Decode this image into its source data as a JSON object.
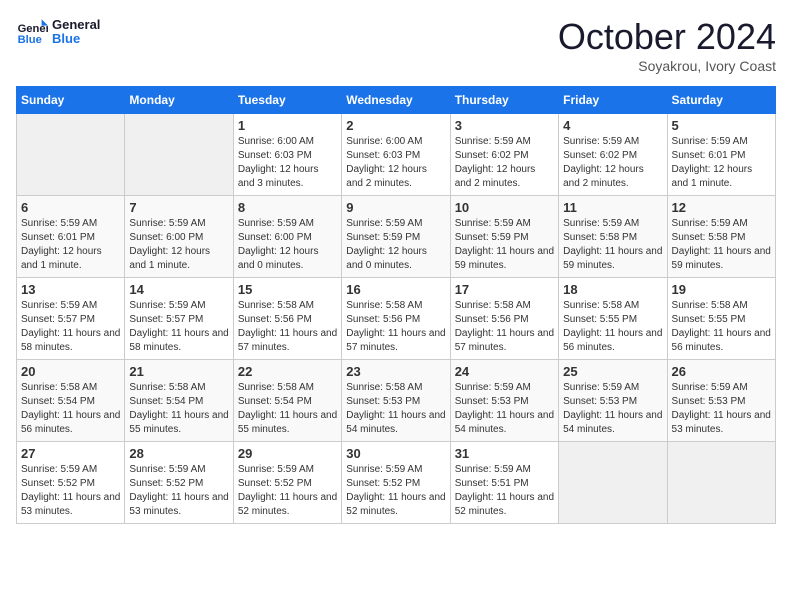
{
  "logo": {
    "text_general": "General",
    "text_blue": "Blue"
  },
  "title": "October 2024",
  "location": "Soyakrou, Ivory Coast",
  "days_of_week": [
    "Sunday",
    "Monday",
    "Tuesday",
    "Wednesday",
    "Thursday",
    "Friday",
    "Saturday"
  ],
  "weeks": [
    [
      {
        "day": "",
        "info": ""
      },
      {
        "day": "",
        "info": ""
      },
      {
        "day": "1",
        "info": "Sunrise: 6:00 AM\nSunset: 6:03 PM\nDaylight: 12 hours and 3 minutes."
      },
      {
        "day": "2",
        "info": "Sunrise: 6:00 AM\nSunset: 6:03 PM\nDaylight: 12 hours and 2 minutes."
      },
      {
        "day": "3",
        "info": "Sunrise: 5:59 AM\nSunset: 6:02 PM\nDaylight: 12 hours and 2 minutes."
      },
      {
        "day": "4",
        "info": "Sunrise: 5:59 AM\nSunset: 6:02 PM\nDaylight: 12 hours and 2 minutes."
      },
      {
        "day": "5",
        "info": "Sunrise: 5:59 AM\nSunset: 6:01 PM\nDaylight: 12 hours and 1 minute."
      }
    ],
    [
      {
        "day": "6",
        "info": "Sunrise: 5:59 AM\nSunset: 6:01 PM\nDaylight: 12 hours and 1 minute."
      },
      {
        "day": "7",
        "info": "Sunrise: 5:59 AM\nSunset: 6:00 PM\nDaylight: 12 hours and 1 minute."
      },
      {
        "day": "8",
        "info": "Sunrise: 5:59 AM\nSunset: 6:00 PM\nDaylight: 12 hours and 0 minutes."
      },
      {
        "day": "9",
        "info": "Sunrise: 5:59 AM\nSunset: 5:59 PM\nDaylight: 12 hours and 0 minutes."
      },
      {
        "day": "10",
        "info": "Sunrise: 5:59 AM\nSunset: 5:59 PM\nDaylight: 11 hours and 59 minutes."
      },
      {
        "day": "11",
        "info": "Sunrise: 5:59 AM\nSunset: 5:58 PM\nDaylight: 11 hours and 59 minutes."
      },
      {
        "day": "12",
        "info": "Sunrise: 5:59 AM\nSunset: 5:58 PM\nDaylight: 11 hours and 59 minutes."
      }
    ],
    [
      {
        "day": "13",
        "info": "Sunrise: 5:59 AM\nSunset: 5:57 PM\nDaylight: 11 hours and 58 minutes."
      },
      {
        "day": "14",
        "info": "Sunrise: 5:59 AM\nSunset: 5:57 PM\nDaylight: 11 hours and 58 minutes."
      },
      {
        "day": "15",
        "info": "Sunrise: 5:58 AM\nSunset: 5:56 PM\nDaylight: 11 hours and 57 minutes."
      },
      {
        "day": "16",
        "info": "Sunrise: 5:58 AM\nSunset: 5:56 PM\nDaylight: 11 hours and 57 minutes."
      },
      {
        "day": "17",
        "info": "Sunrise: 5:58 AM\nSunset: 5:56 PM\nDaylight: 11 hours and 57 minutes."
      },
      {
        "day": "18",
        "info": "Sunrise: 5:58 AM\nSunset: 5:55 PM\nDaylight: 11 hours and 56 minutes."
      },
      {
        "day": "19",
        "info": "Sunrise: 5:58 AM\nSunset: 5:55 PM\nDaylight: 11 hours and 56 minutes."
      }
    ],
    [
      {
        "day": "20",
        "info": "Sunrise: 5:58 AM\nSunset: 5:54 PM\nDaylight: 11 hours and 56 minutes."
      },
      {
        "day": "21",
        "info": "Sunrise: 5:58 AM\nSunset: 5:54 PM\nDaylight: 11 hours and 55 minutes."
      },
      {
        "day": "22",
        "info": "Sunrise: 5:58 AM\nSunset: 5:54 PM\nDaylight: 11 hours and 55 minutes."
      },
      {
        "day": "23",
        "info": "Sunrise: 5:58 AM\nSunset: 5:53 PM\nDaylight: 11 hours and 54 minutes."
      },
      {
        "day": "24",
        "info": "Sunrise: 5:59 AM\nSunset: 5:53 PM\nDaylight: 11 hours and 54 minutes."
      },
      {
        "day": "25",
        "info": "Sunrise: 5:59 AM\nSunset: 5:53 PM\nDaylight: 11 hours and 54 minutes."
      },
      {
        "day": "26",
        "info": "Sunrise: 5:59 AM\nSunset: 5:53 PM\nDaylight: 11 hours and 53 minutes."
      }
    ],
    [
      {
        "day": "27",
        "info": "Sunrise: 5:59 AM\nSunset: 5:52 PM\nDaylight: 11 hours and 53 minutes."
      },
      {
        "day": "28",
        "info": "Sunrise: 5:59 AM\nSunset: 5:52 PM\nDaylight: 11 hours and 53 minutes."
      },
      {
        "day": "29",
        "info": "Sunrise: 5:59 AM\nSunset: 5:52 PM\nDaylight: 11 hours and 52 minutes."
      },
      {
        "day": "30",
        "info": "Sunrise: 5:59 AM\nSunset: 5:52 PM\nDaylight: 11 hours and 52 minutes."
      },
      {
        "day": "31",
        "info": "Sunrise: 5:59 AM\nSunset: 5:51 PM\nDaylight: 11 hours and 52 minutes."
      },
      {
        "day": "",
        "info": ""
      },
      {
        "day": "",
        "info": ""
      }
    ]
  ]
}
